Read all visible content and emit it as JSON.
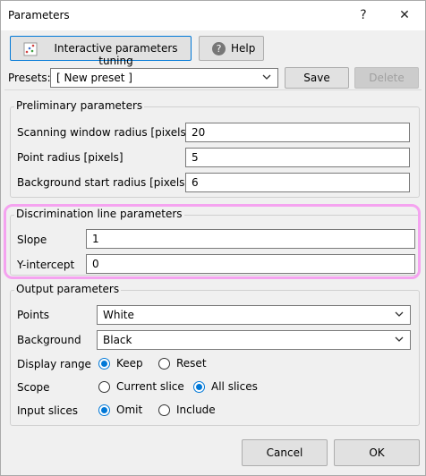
{
  "window": {
    "title": "Parameters"
  },
  "toolbar": {
    "tuning_label": "Interactive parameters tuning",
    "help_label": "Help",
    "presets_label": "Presets:",
    "preset_value": "[ New preset ]",
    "save_label": "Save",
    "delete_label": "Delete"
  },
  "preliminary": {
    "title": "Preliminary parameters",
    "fields": [
      {
        "label": "Scanning window radius [pixels]",
        "value": "20"
      },
      {
        "label": "Point radius [pixels]",
        "value": "5"
      },
      {
        "label": "Background start radius [pixels]",
        "value": "6"
      }
    ]
  },
  "discrimination": {
    "title": "Discrimination line parameters",
    "fields": [
      {
        "label": "Slope",
        "value": "1"
      },
      {
        "label": "Y-intercept",
        "value": "0"
      }
    ]
  },
  "output": {
    "title": "Output parameters",
    "points_label": "Points",
    "points_value": "White",
    "background_label": "Background",
    "background_value": "Black",
    "display_range": {
      "label": "Display range",
      "options": [
        "Keep",
        "Reset"
      ],
      "selected": "Keep"
    },
    "scope": {
      "label": "Scope",
      "options": [
        "Current slice",
        "All slices"
      ],
      "selected": "All slices"
    },
    "input_slices": {
      "label": "Input slices",
      "options": [
        "Omit",
        "Include"
      ],
      "selected": "Omit"
    }
  },
  "footer": {
    "cancel_label": "Cancel",
    "ok_label": "OK"
  },
  "colors": {
    "accent": "#0078d7",
    "highlight": "#f5a3f0"
  }
}
